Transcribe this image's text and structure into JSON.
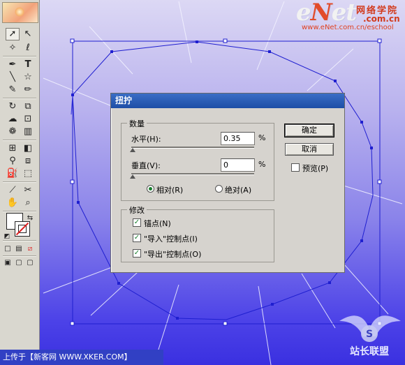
{
  "watermark": {
    "brand_prefix": "e",
    "brand_accent": "N",
    "brand_suffix": "et",
    "brand_cn": "网络学院",
    "brand_domain": ".com.cn",
    "url": "www.eNet.com.cn/eschool"
  },
  "dialog": {
    "title": "扭拧",
    "amount_group": "数量",
    "horizontal_label": "水平(H):",
    "horizontal_value": "0.35",
    "horizontal_unit": "%",
    "vertical_label": "垂直(V):",
    "vertical_value": "0",
    "vertical_unit": "%",
    "relative_label": "相对(R)",
    "absolute_label": "绝对(A)",
    "modify_group": "修改",
    "anchor_label": "锚点(N)",
    "in_control_label": "\"导入\"控制点(I)",
    "out_control_label": "\"导出\"控制点(O)",
    "ok_label": "确定",
    "cancel_label": "取消",
    "preview_label": "预览(P)",
    "relative_selected": true,
    "anchor_checked": true,
    "in_checked": true,
    "out_checked": true,
    "preview_checked": false
  },
  "toolbox": {
    "tools": [
      "selection-tool",
      "direct-selection-tool",
      "magic-wand-tool",
      "lasso-tool",
      "pen-tool",
      "type-tool",
      "line-tool",
      "star-tool",
      "paintbrush-tool",
      "pencil-tool",
      "rotate-tool",
      "scale-tool",
      "warp-tool",
      "free-transform-tool",
      "symbol-sprayer-tool",
      "column-graph-tool",
      "mesh-tool",
      "gradient-tool",
      "eyedropper-tool",
      "blend-tool",
      "live-paint-tool",
      "live-paint-selection-tool",
      "slice-tool",
      "scissors-tool",
      "hand-tool",
      "zoom-tool"
    ]
  },
  "footer": {
    "caption": "上传于【新客网 WWW.XKER.COM】"
  },
  "emblem": {
    "text": "站长联盟"
  },
  "colors": {
    "accent": "#1e4ea6",
    "path": "#1f1fd0",
    "brand_red": "#d23a1c"
  }
}
